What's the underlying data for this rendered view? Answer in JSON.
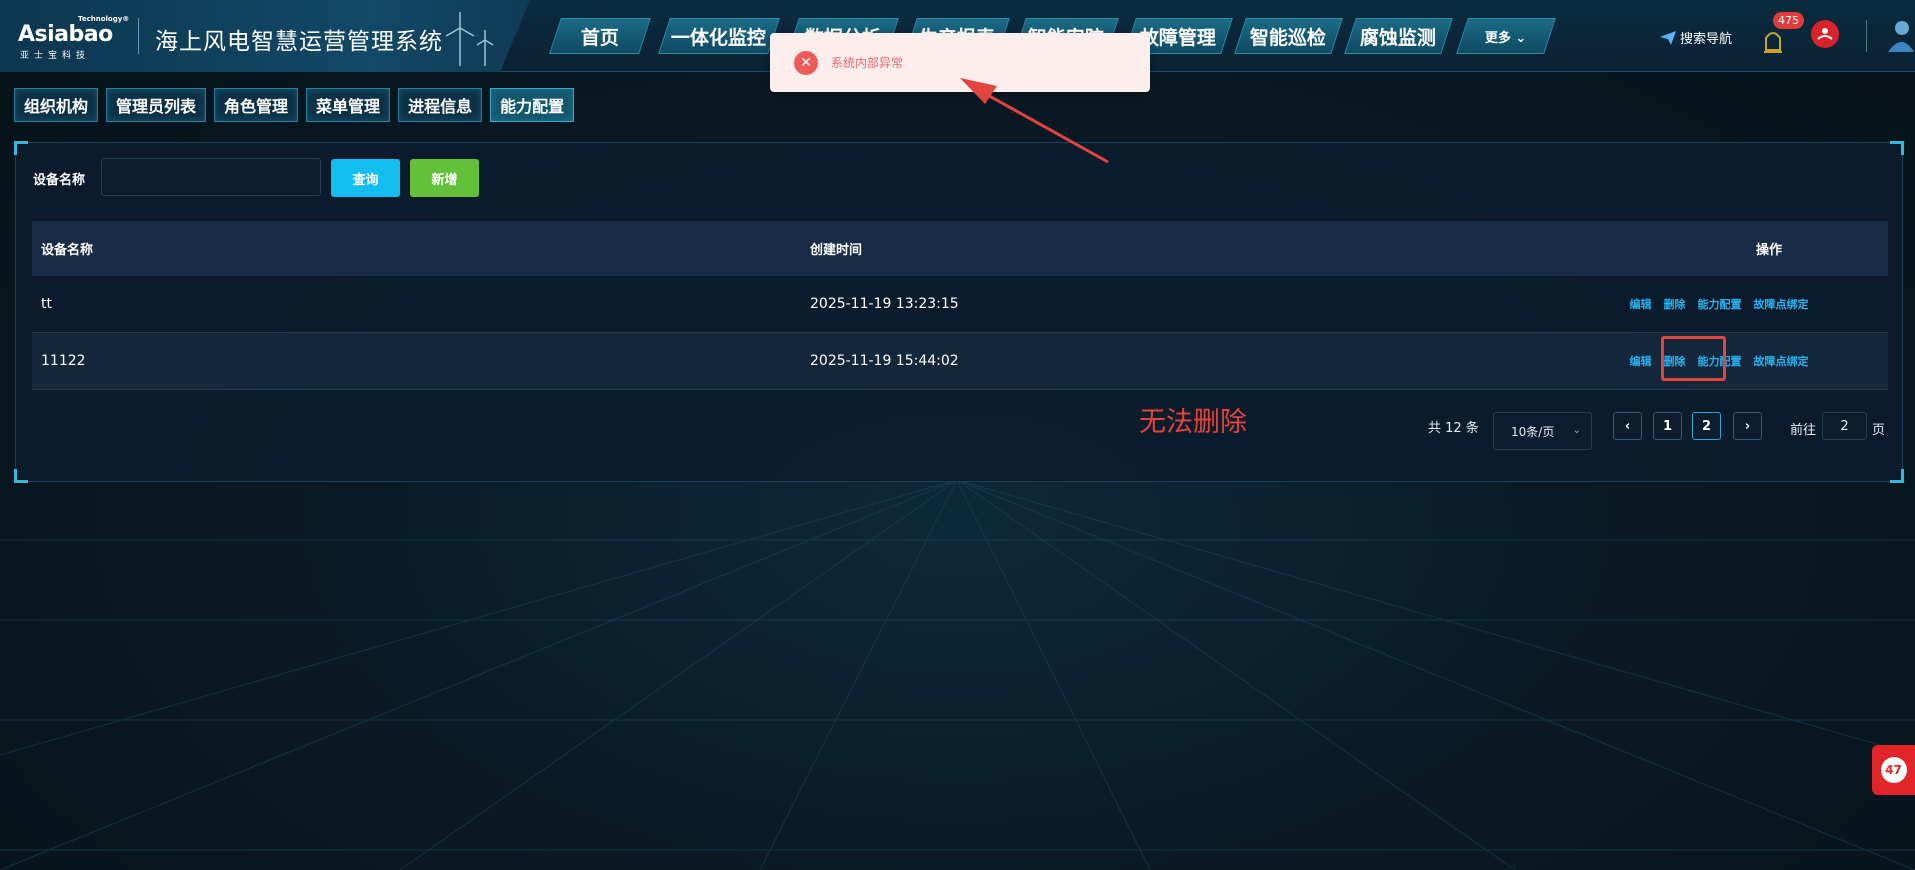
{
  "header": {
    "logo_top": "Technology®",
    "logo_main": "Asiabao",
    "logo_sub": "亚士宝科技",
    "system_title": "海上风电智慧运营管理系统",
    "nav_tabs": [
      {
        "label": "首页"
      },
      {
        "label": "一体化监控"
      },
      {
        "label": "数据分析"
      },
      {
        "label": "生产报表"
      },
      {
        "label": "智能安防"
      },
      {
        "label": "故障管理"
      },
      {
        "label": "智能巡检"
      },
      {
        "label": "腐蚀监测"
      },
      {
        "label": "更多"
      }
    ],
    "search_nav": "搜索导航",
    "alarm_count": "475"
  },
  "subtabs": [
    {
      "label": "组织机构"
    },
    {
      "label": "管理员列表"
    },
    {
      "label": "角色管理"
    },
    {
      "label": "菜单管理"
    },
    {
      "label": "进程信息"
    },
    {
      "label": "能力配置",
      "active": true
    }
  ],
  "filter": {
    "label": "设备名称",
    "value": "",
    "query_label": "查询",
    "add_label": "新增"
  },
  "table": {
    "headers": {
      "name": "设备名称",
      "time": "创建时间",
      "ops": "操作"
    },
    "rows": [
      {
        "name": "tt",
        "time": "2025-11-19 13:23:15"
      },
      {
        "name": "11122",
        "time": "2025-11-19 15:44:02"
      }
    ],
    "ops": {
      "edit": "编辑",
      "delete": "删除",
      "capability": "能力配置",
      "fault_bind": "故障点绑定"
    }
  },
  "pagination": {
    "total_text": "共 12 条",
    "page_size": "10条/页",
    "pages": [
      "1",
      "2"
    ],
    "current_page": "2",
    "goto_label": "前往",
    "goto_value": "2",
    "goto_suffix": "页",
    "prev_icon": "chevron-left-icon",
    "next_icon": "chevron-right-icon"
  },
  "toast": {
    "message": "系统内部异常",
    "icon": "error-circle-icon"
  },
  "annotation": {
    "text": "无法删除"
  },
  "float_badge": "47",
  "colors": {
    "accent": "#14bdf0",
    "add_green": "#62c03a",
    "link_blue": "#28b3f0",
    "annotation_red": "#e2453d",
    "toast_bg": "#fdeeee"
  }
}
